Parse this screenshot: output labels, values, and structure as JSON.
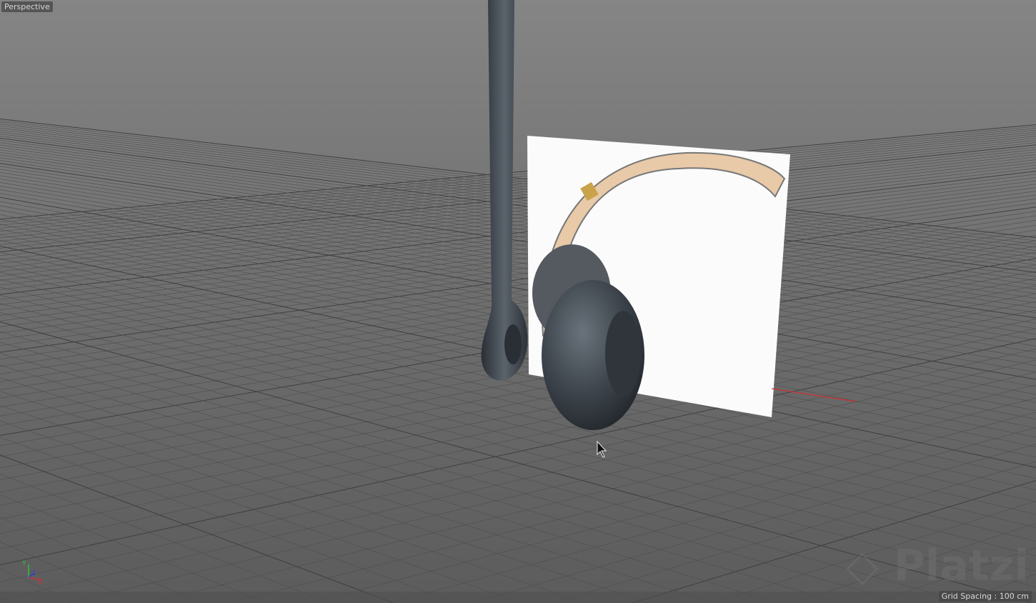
{
  "viewport": {
    "view_name": "Perspective",
    "grid_spacing": "Grid Spacing : 100 cm",
    "axes": {
      "y": "Y",
      "z": "Z",
      "x": "X"
    },
    "watermark": "Platzi",
    "colors": {
      "x_axis": "#d03030",
      "y_axis": "#30c040",
      "z_axis": "#3040d0",
      "model": "#3e444b",
      "band": "#e8c9a8"
    }
  }
}
